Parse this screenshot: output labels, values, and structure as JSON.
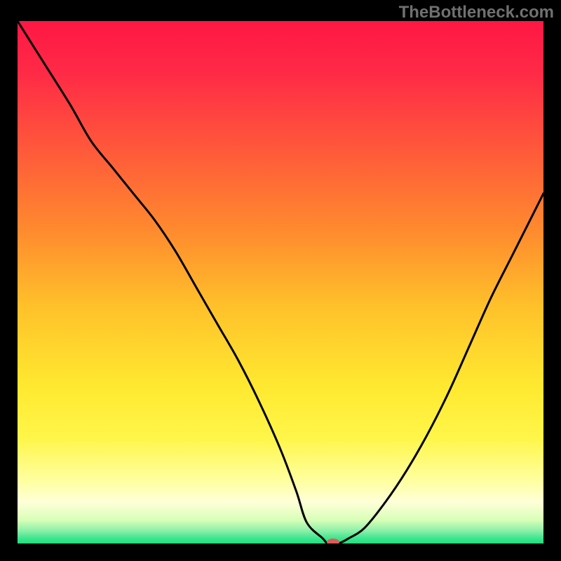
{
  "watermark": "TheBottleneck.com",
  "chart_data": {
    "type": "line",
    "title": "",
    "xlabel": "",
    "ylabel": "",
    "xlim": [
      0,
      100
    ],
    "ylim": [
      0,
      100
    ],
    "x": [
      0,
      5,
      10,
      14,
      18,
      22,
      26,
      30,
      34,
      38,
      42,
      46,
      50,
      53,
      55,
      58,
      59,
      61,
      63,
      66,
      70,
      74,
      78,
      82,
      86,
      90,
      94,
      98,
      100
    ],
    "values": [
      100,
      92,
      84,
      77,
      72,
      67,
      62,
      56,
      49,
      42,
      35,
      27,
      18,
      10,
      4,
      1,
      0,
      0,
      1,
      3,
      8,
      14,
      21,
      29,
      38,
      47,
      55,
      63,
      67
    ],
    "marker": {
      "x": 60,
      "y": 0,
      "color": "#e05a5a",
      "rx": 9,
      "ry": 5
    },
    "gradient_stops": [
      {
        "offset": 0.0,
        "color": "#ff1744"
      },
      {
        "offset": 0.1,
        "color": "#ff2a46"
      },
      {
        "offset": 0.25,
        "color": "#ff5a3a"
      },
      {
        "offset": 0.4,
        "color": "#ff8a2e"
      },
      {
        "offset": 0.55,
        "color": "#ffc22a"
      },
      {
        "offset": 0.7,
        "color": "#ffe930"
      },
      {
        "offset": 0.8,
        "color": "#fff64a"
      },
      {
        "offset": 0.88,
        "color": "#ffffa0"
      },
      {
        "offset": 0.92,
        "color": "#ffffd8"
      },
      {
        "offset": 0.955,
        "color": "#d8ffb8"
      },
      {
        "offset": 0.975,
        "color": "#8ff0a8"
      },
      {
        "offset": 0.99,
        "color": "#3de68f"
      },
      {
        "offset": 1.0,
        "color": "#1de080"
      }
    ]
  }
}
